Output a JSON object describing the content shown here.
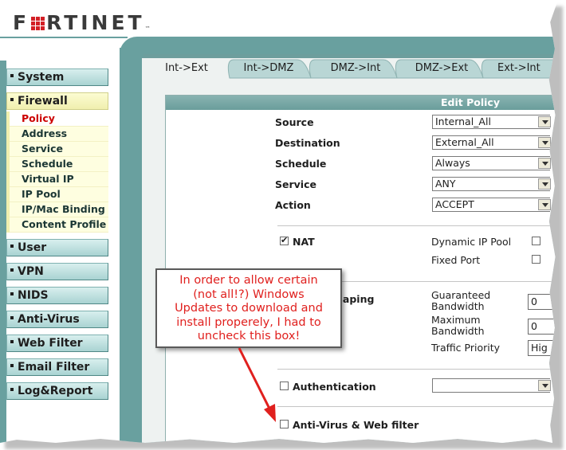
{
  "brand": {
    "name": "FORTINET"
  },
  "sidebar": {
    "items": [
      {
        "label": "System"
      },
      {
        "label": "Firewall"
      },
      {
        "label": "User"
      },
      {
        "label": "VPN"
      },
      {
        "label": "NIDS"
      },
      {
        "label": "Anti-Virus"
      },
      {
        "label": "Web Filter"
      },
      {
        "label": "Email Filter"
      },
      {
        "label": "Log&Report"
      }
    ],
    "firewall_sub": [
      {
        "label": "Policy"
      },
      {
        "label": "Address"
      },
      {
        "label": "Service"
      },
      {
        "label": "Schedule"
      },
      {
        "label": "Virtual IP"
      },
      {
        "label": "IP Pool"
      },
      {
        "label": "IP/Mac Binding"
      },
      {
        "label": "Content Profile"
      }
    ]
  },
  "tabs": [
    {
      "label": "Int->Ext"
    },
    {
      "label": "Int->DMZ"
    },
    {
      "label": "DMZ->Int"
    },
    {
      "label": "DMZ->Ext"
    },
    {
      "label": "Ext->Int"
    }
  ],
  "form": {
    "title": "Edit Policy",
    "source_label": "Source",
    "source_value": "Internal_All",
    "destination_label": "Destination",
    "destination_value": "External_All",
    "schedule_label": "Schedule",
    "schedule_value": "Always",
    "service_label": "Service",
    "service_value": "ANY",
    "action_label": "Action",
    "action_value": "ACCEPT",
    "nat_label": "NAT",
    "dynamic_ip_label": "Dynamic IP Pool",
    "fixed_port_label": "Fixed Port",
    "shaping_label": "Shaping",
    "guaranteed_bw_label_1": "Guaranteed",
    "guaranteed_bw_label_2": "Bandwidth",
    "guaranteed_bw_value": "0",
    "maximum_bw_label_1": "Maximum",
    "maximum_bw_label_2": "Bandwidth",
    "maximum_bw_value": "0",
    "traffic_priority_label": "Traffic Priority",
    "traffic_priority_value": "Hig",
    "authentication_label": "Authentication",
    "antivirus_label": "Anti-Virus & Web filter"
  },
  "annotation": {
    "lines": [
      "In order to allow certain",
      "(not all!?) Windows",
      "Updates to download and",
      "install properely, I had to",
      "uncheck this box!"
    ]
  },
  "colors": {
    "accent_teal": "#69a09f",
    "annotation_red": "#e0201e",
    "logo_red": "#d31f26"
  }
}
